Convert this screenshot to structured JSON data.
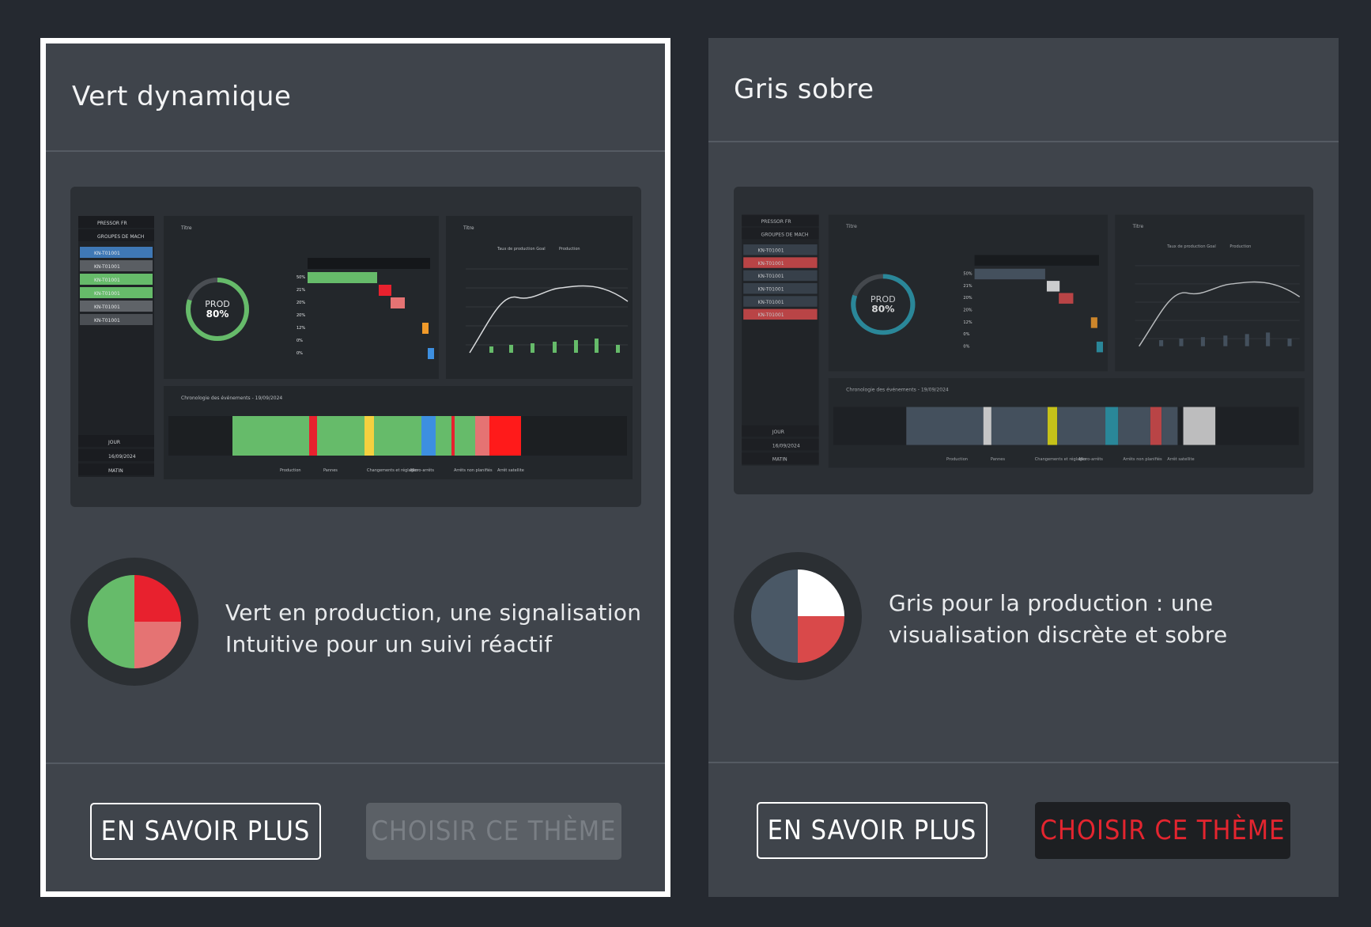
{
  "themes": [
    {
      "title": "Vert dynamique",
      "description_line1": "Vert en production, une signalisation",
      "description_line2": "Intuitive pour un suivi réactif",
      "learn_more_label": "EN SAVOIR PLUS",
      "choose_label": "CHOISIR CE THÈME",
      "selected": true,
      "choose_disabled": true,
      "colors": {
        "production": "#66bb6a",
        "stop": "#e8212e",
        "breakdown": "#e57373",
        "ring": "#2b2f33"
      },
      "pie": [
        {
          "label": "production",
          "fraction": 0.5,
          "color": "#66bb6a"
        },
        {
          "label": "stop",
          "fraction": 0.25,
          "color": "#e8212e"
        },
        {
          "label": "breakdown",
          "fraction": 0.25,
          "color": "#e57373"
        }
      ]
    },
    {
      "title": "Gris sobre",
      "description_line1": "Gris pour la production : une",
      "description_line2": "visualisation discrète et sobre",
      "learn_more_label": "EN SAVOIR PLUS",
      "choose_label": "CHOISIR CE THÈME",
      "selected": false,
      "choose_disabled": false,
      "colors": {
        "production": "#4a5866",
        "stop": "#ffffff",
        "breakdown": "#d9494a",
        "ring": "#2b2f33"
      },
      "pie": [
        {
          "label": "production",
          "fraction": 0.5,
          "color": "#4a5866"
        },
        {
          "label": "stop",
          "fraction": 0.25,
          "color": "#ffffff"
        },
        {
          "label": "breakdown",
          "fraction": 0.25,
          "color": "#d9494a"
        }
      ]
    }
  ],
  "preview": {
    "sidebar_top": [
      "PRESSOR FR",
      "GROUPES DE MACH"
    ],
    "machines": [
      "KN-T01001",
      "KN-T01001",
      "KN-T01001",
      "KN-T01001",
      "KN-T01001",
      "KN-T01001"
    ],
    "sidebar_bottom": [
      "JOUR",
      "16/09/2024",
      "MATIN"
    ],
    "panel_title": "Titre",
    "gauge_label": "PROD",
    "gauge_value": "80%",
    "timeline_title": "Chronologie des événements - 19/09/2024",
    "legend_line_1": "Taux de production Goal",
    "legend_line_2": "Production",
    "bar_pcts": [
      "50%",
      "21%",
      "20%",
      "20%",
      "12%",
      "0%",
      "0%"
    ],
    "timeline_legend": [
      "Production",
      "Pannes",
      "Changements et réglages",
      "Micro-arrêts",
      "Arrêts non planifiés",
      "Arrêt satellite"
    ]
  }
}
